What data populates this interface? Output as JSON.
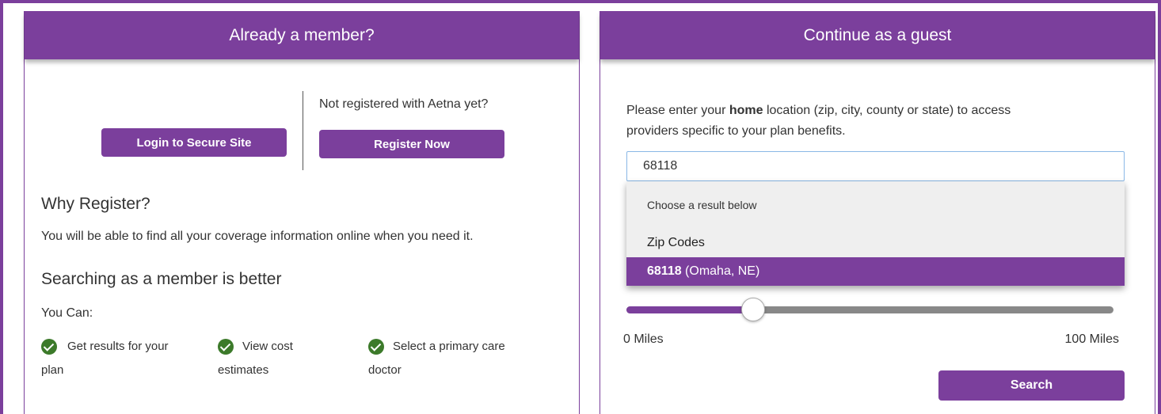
{
  "member_panel": {
    "header": "Already a member?",
    "login_button": "Login to Secure Site",
    "not_registered_text": "Not registered with Aetna yet?",
    "register_button": "Register Now",
    "why_register_heading": "Why Register?",
    "why_register_text": "You will be able to find all your coverage information online when you need it.",
    "searching_heading": "Searching as a member is better",
    "you_can_label": "You Can:",
    "features": [
      {
        "line1": "Get results for your",
        "line2": "plan"
      },
      {
        "line1": "View cost",
        "line2": "estimates"
      },
      {
        "line1": "Select a primary care",
        "line2": "doctor"
      }
    ]
  },
  "guest_panel": {
    "header": "Continue as a guest",
    "instruction_before": "Please enter your ",
    "instruction_bold": "home",
    "instruction_after": " location (zip, city, county or state) to access",
    "instruction_line2": "providers specific to your plan benefits.",
    "location_input_value": "68118",
    "dropdown": {
      "hint": "Choose a result below",
      "group_label": "Zip Codes",
      "result_zip": "68118",
      "result_place": " (Omaha, NE)"
    },
    "distance": {
      "min_label": "0 Miles",
      "max_label": "100 Miles",
      "value_fraction": 0.26
    },
    "search_button": "Search"
  },
  "colors": {
    "brand_purple": "#7b3f9c",
    "check_green": "#3c7a2a"
  }
}
